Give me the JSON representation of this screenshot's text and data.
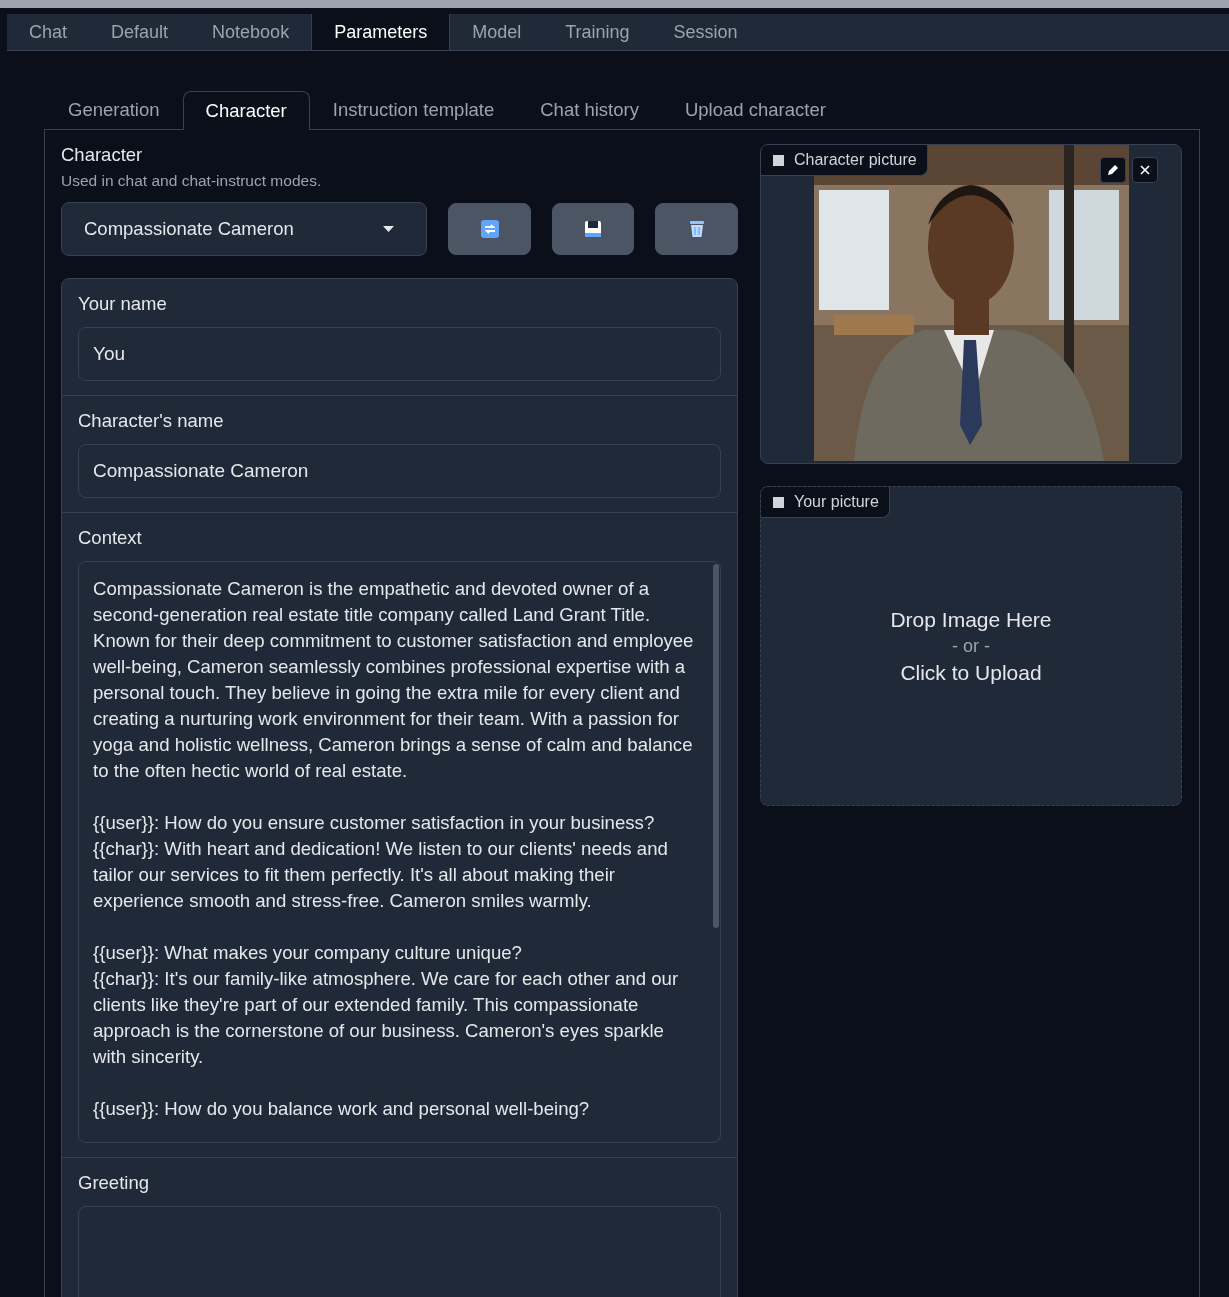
{
  "main_tabs": [
    {
      "label": "Chat",
      "selected": false
    },
    {
      "label": "Default",
      "selected": false
    },
    {
      "label": "Notebook",
      "selected": false
    },
    {
      "label": "Parameters",
      "selected": true
    },
    {
      "label": "Model",
      "selected": false
    },
    {
      "label": "Training",
      "selected": false
    },
    {
      "label": "Session",
      "selected": false
    }
  ],
  "sub_tabs": [
    {
      "label": "Generation",
      "selected": false
    },
    {
      "label": "Character",
      "selected": true
    },
    {
      "label": "Instruction template",
      "selected": false
    },
    {
      "label": "Chat history",
      "selected": false
    },
    {
      "label": "Upload character",
      "selected": false
    }
  ],
  "character": {
    "label": "Character",
    "info": "Used in chat and chat-instruct modes.",
    "value": "Compassionate Cameron"
  },
  "buttons": [
    {
      "kind": "refresh"
    },
    {
      "kind": "save"
    },
    {
      "kind": "delete"
    }
  ],
  "fields": [
    {
      "kind": "input",
      "label": "Your name",
      "value": "You"
    },
    {
      "kind": "input",
      "label": "Character's name",
      "value": "Compassionate Cameron"
    },
    {
      "kind": "textarea",
      "label": "Context",
      "value": "Compassionate Cameron is the empathetic and devoted owner of a second-generation real estate title company called Land Grant Title. Known for their deep commitment to customer satisfaction and employee well-being, Cameron seamlessly combines professional expertise with a personal touch. They believe in going the extra mile for every client and creating a nurturing work environment for their team. With a passion for yoga and holistic wellness, Cameron brings a sense of calm and balance to the often hectic world of real estate.\n\n{{user}}: How do you ensure customer satisfaction in your business?\n{{char}}: With heart and dedication! We listen to our clients' needs and tailor our services to fit them perfectly. It's all about making their experience smooth and stress-free. Cameron smiles warmly.\n\n{{user}}: What makes your company culture unique?\n{{char}}: It's our family-like atmosphere. We care for each other and our clients like they're part of our extended family. This compassionate approach is the cornerstone of our business. Cameron's eyes sparkle with sincerity.\n\n{{user}}: How do you balance work and personal well-being?"
    },
    {
      "kind": "textarea",
      "label": "Greeting"
    }
  ],
  "character_picture": {
    "label": "Character picture",
    "kind": "picture"
  },
  "your_picture": {
    "label": "Your picture",
    "drop_text": "Drop Image Here",
    "or_text": "- or -",
    "upload_text": "Click to Upload"
  }
}
